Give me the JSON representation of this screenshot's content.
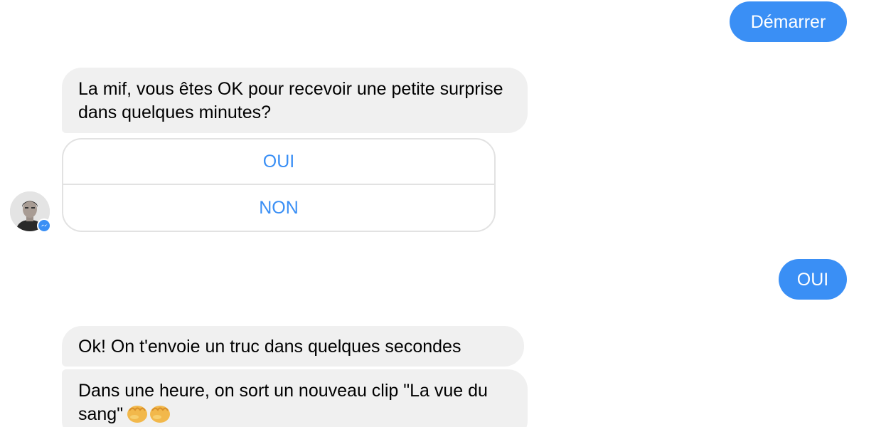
{
  "messages": {
    "start_button": "Démarrer",
    "prompt": "La mif, vous êtes OK pour recevoir une petite surprise dans quelques minutes?",
    "quick_replies": [
      "OUI",
      "NON"
    ],
    "user_reply": "OUI",
    "ack": "Ok! On t'envoie un truc dans quelques secondes",
    "announce": "Dans une heure, on sort un nouveau clip  \"La vue du sang\""
  },
  "colors": {
    "outgoing_bubble": "#3a8ff5",
    "incoming_bubble": "#f0f0f0",
    "quick_reply_text": "#3a8ff5"
  },
  "icons": {
    "avatar": "avatar-photo",
    "badge": "messenger-icon",
    "emoji": "oncoming-fist-emoji"
  }
}
